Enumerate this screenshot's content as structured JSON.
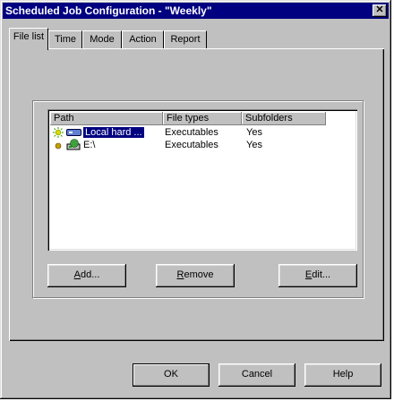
{
  "window": {
    "title": "Scheduled Job Configuration - \"Weekly\"",
    "close_label": "✕"
  },
  "tabs": [
    {
      "label": "File list",
      "active": true
    },
    {
      "label": "Time",
      "active": false
    },
    {
      "label": "Mode",
      "active": false
    },
    {
      "label": "Action",
      "active": false
    },
    {
      "label": "Report",
      "active": false
    }
  ],
  "list": {
    "columns": [
      "Path",
      "File types",
      "Subfolders"
    ],
    "rows": [
      {
        "path": "Local hard ...",
        "file_types": "Executables",
        "subfolders": "Yes",
        "selected": true,
        "icon": "hard-drive-icon",
        "status_icon": "sun-icon"
      },
      {
        "path": "E:\\",
        "file_types": "Executables",
        "subfolders": "Yes",
        "selected": false,
        "icon": "network-drive-icon",
        "status_icon": "bullet-icon"
      }
    ]
  },
  "buttons": {
    "add": {
      "mnemonic": "A",
      "rest": "dd..."
    },
    "remove": {
      "mnemonic": "R",
      "rest": "emove"
    },
    "edit": {
      "mnemonic": "E",
      "rest": "dit..."
    },
    "ok": "OK",
    "cancel": "Cancel",
    "help": "Help"
  }
}
